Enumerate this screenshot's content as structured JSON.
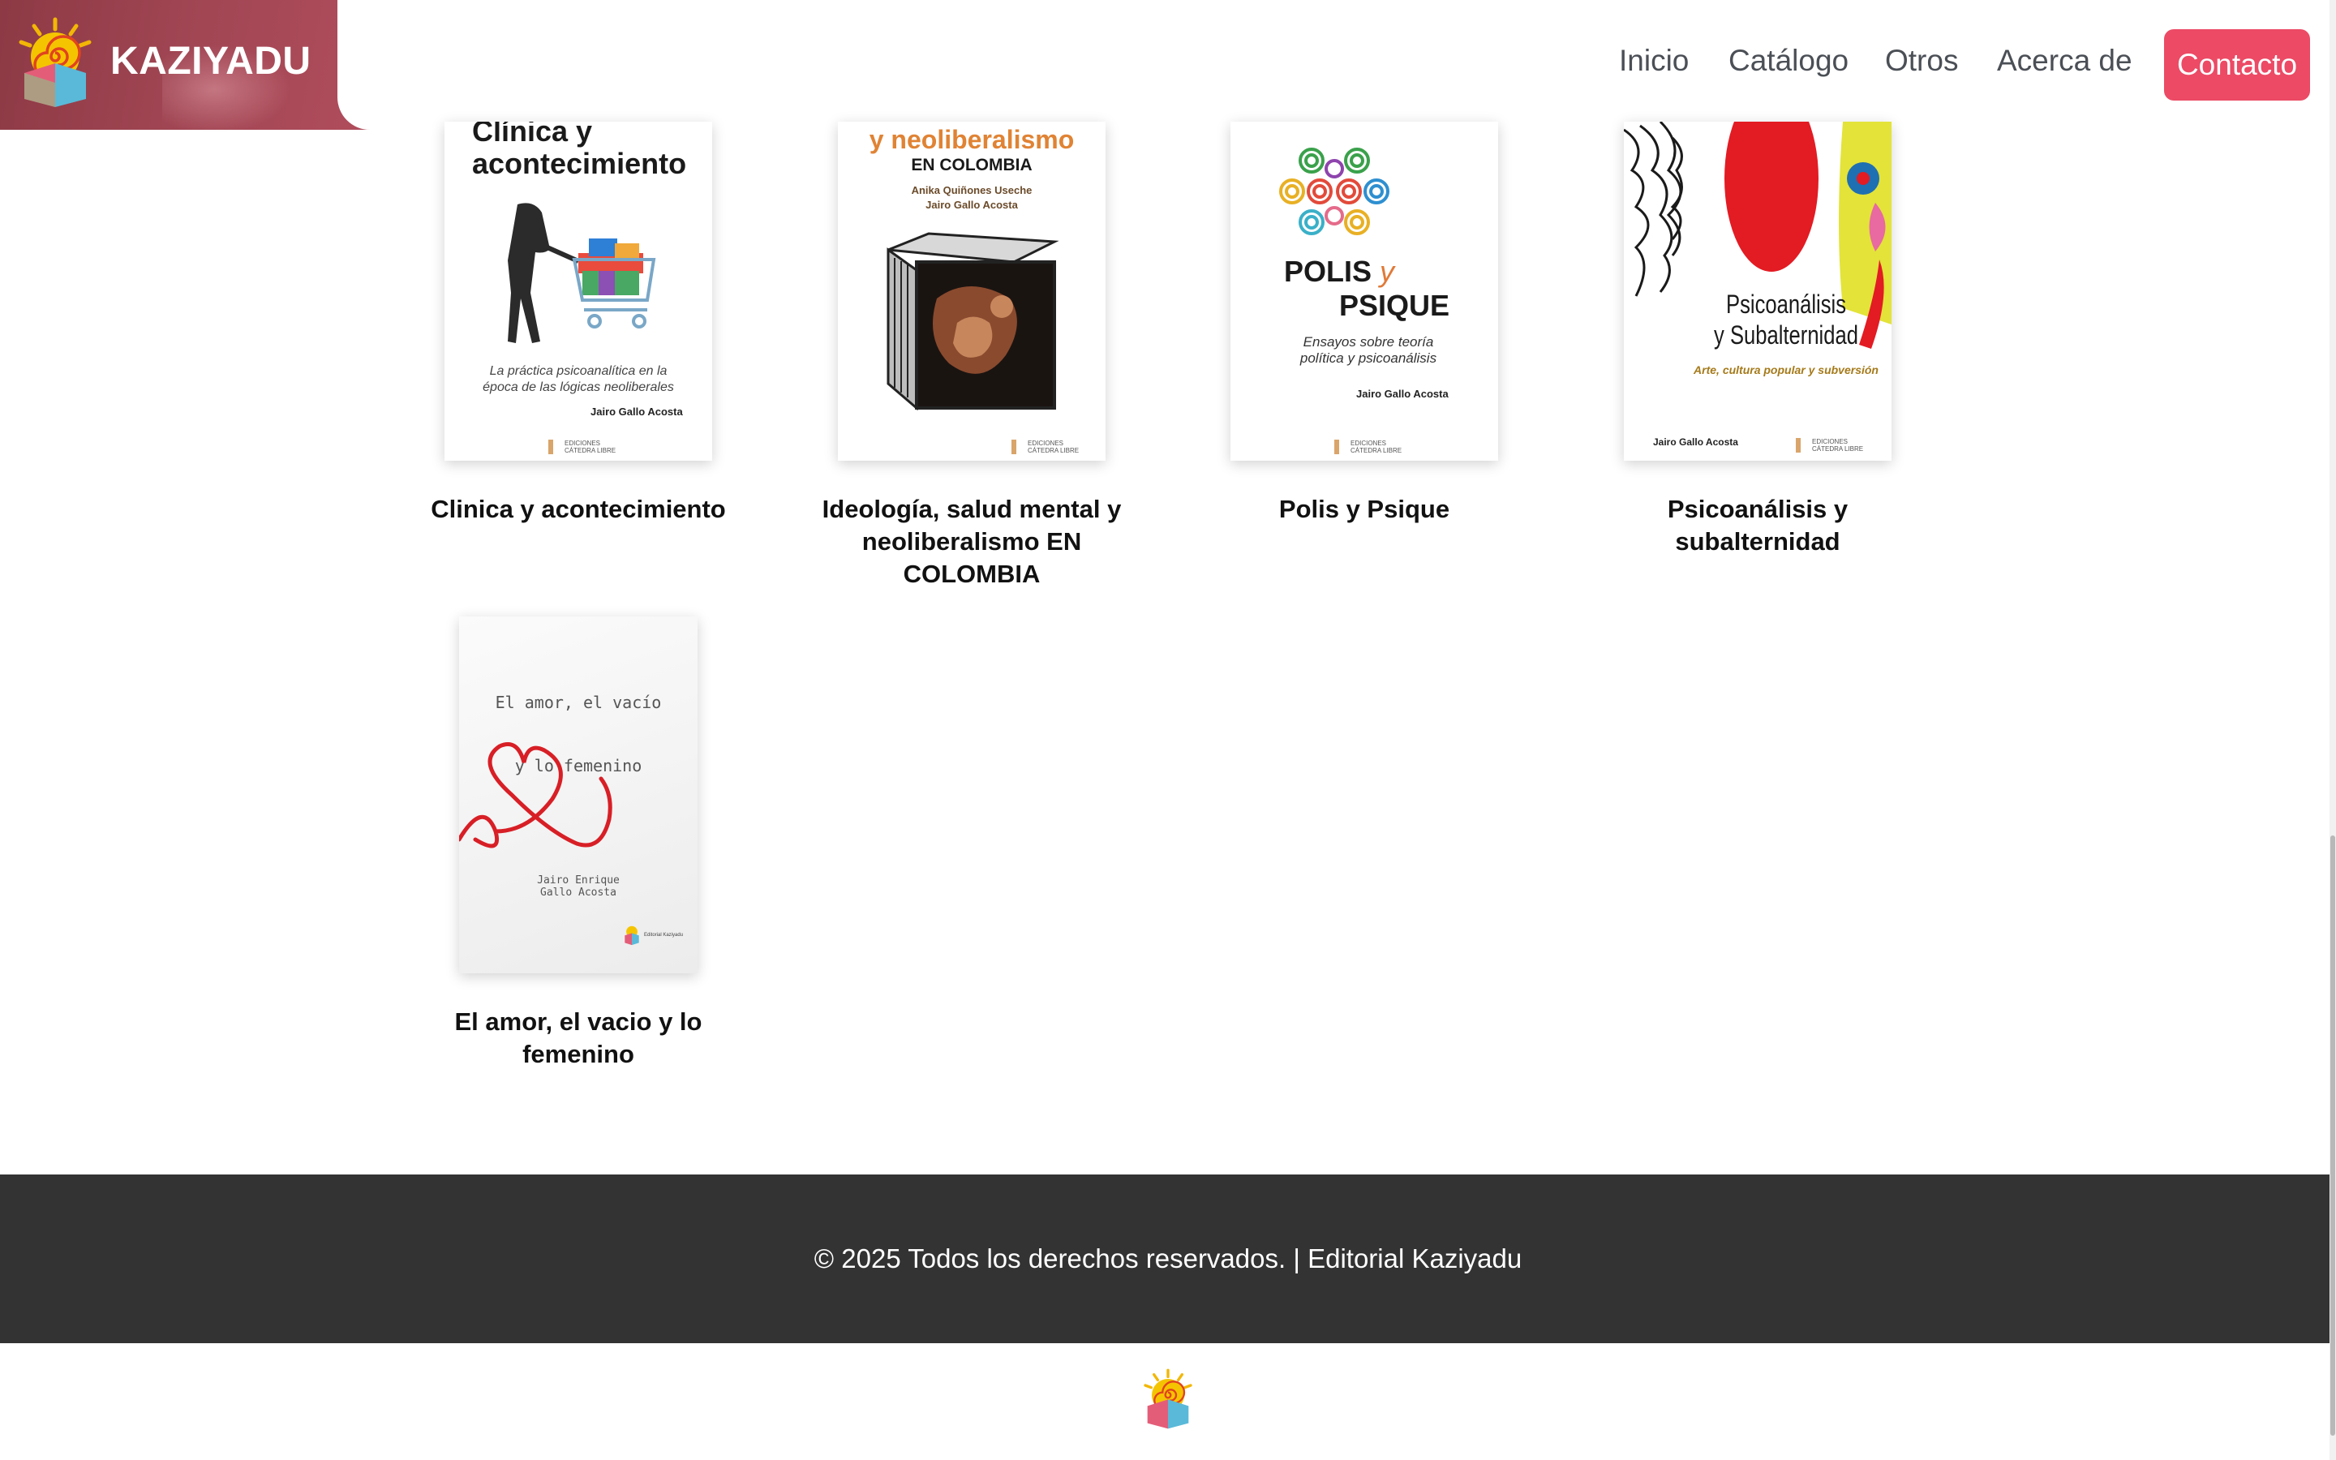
{
  "header": {
    "brand": "KAZIYADU",
    "nav": {
      "home": "Inicio",
      "catalog": "Catálogo",
      "others": "Otros",
      "about": "Acerca de",
      "contact": "Contacto"
    }
  },
  "books": [
    {
      "title": "Clinica y acontecimiento",
      "cover": {
        "heading": "Clínica y\nacontecimiento",
        "subtitle": "La práctica psicoanalítica en la\népoca de las lógicas neoliberales",
        "author": "Jairo Gallo Acosta",
        "publisher": "EDICIONES\nCÁTEDRA LIBRE"
      }
    },
    {
      "title": "Ideología, salud mental y neoliberalismo EN COLOMBIA",
      "cover": {
        "heading": "y neoliberalismo",
        "heading2": "EN COLOMBIA",
        "authors": "Anika Quiñones Useche\nJairo Gallo Acosta",
        "publisher": "EDICIONES\nCÁTEDRA LIBRE"
      }
    },
    {
      "title": "Polis y Psique",
      "cover": {
        "heading_a": "POLIS",
        "heading_y": "y",
        "heading_b": "PSIQUE",
        "subtitle": "Ensayos sobre teoría\npolítica y psicoanálisis",
        "author": "Jairo Gallo Acosta",
        "publisher": "EDICIONES\nCÁTEDRA LIBRE"
      }
    },
    {
      "title": "Psicoanálisis y subalternidad",
      "cover": {
        "heading": "Psicoanálisis\ny Subalternidad",
        "subtitle": "Arte, cultura popular y subversión",
        "author": "Jairo Gallo Acosta",
        "publisher": "EDICIONES\nCÁTEDRA LIBRE"
      }
    },
    {
      "title": "El amor, el vacio y lo femenino",
      "cover": {
        "line1": "El amor, el vacío",
        "line2": "y lo femenino",
        "author": "Jairo Enrique\nGallo Acosta",
        "publisher": "Editorial Kaziyadu"
      }
    }
  ],
  "footer": {
    "text": "© 2025 Todos los derechos reservados. | Editorial Kaziyadu"
  },
  "colors": {
    "accent": "#ec4a65",
    "brand_bg": "#a24654",
    "footer_bg": "#333333"
  },
  "icons": {
    "logo": "sun-over-book-logo-icon"
  }
}
